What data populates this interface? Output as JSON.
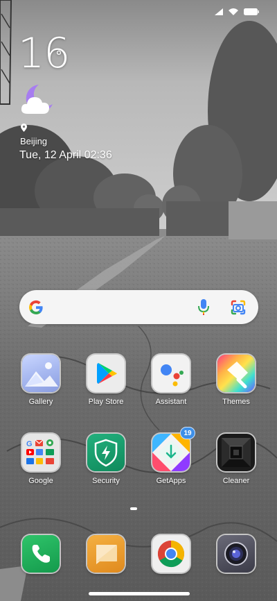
{
  "status_bar": {
    "icons": [
      "signal-icon",
      "wifi-icon",
      "battery-icon"
    ]
  },
  "weather": {
    "temperature": "16",
    "degree_symbol": "°",
    "condition_icon": "partly-cloudy-night-icon",
    "location": "Beijing",
    "datetime": "Tue, 12 April 02:36"
  },
  "search": {
    "logo": "google-g-icon",
    "mic": "microphone-icon",
    "lens": "google-lens-icon"
  },
  "apps_row1": [
    {
      "label": "Gallery",
      "icon": "gallery-icon"
    },
    {
      "label": "Play Store",
      "icon": "play-store-icon"
    },
    {
      "label": "Assistant",
      "icon": "assistant-icon"
    },
    {
      "label": "Themes",
      "icon": "themes-icon"
    }
  ],
  "apps_row2": [
    {
      "label": "Google",
      "icon": "google-folder-icon"
    },
    {
      "label": "Security",
      "icon": "security-shield-icon"
    },
    {
      "label": "GetApps",
      "icon": "getapps-icon",
      "badge": "19"
    },
    {
      "label": "Cleaner",
      "icon": "cleaner-icon"
    }
  ],
  "dock": [
    {
      "icon": "phone-icon"
    },
    {
      "icon": "messages-icon"
    },
    {
      "icon": "chrome-icon"
    },
    {
      "icon": "camera-icon"
    }
  ],
  "colors": {
    "badge": "#3d8fe8",
    "search_bg": "#f5f5f5",
    "weather_icon": "#a77df0"
  }
}
